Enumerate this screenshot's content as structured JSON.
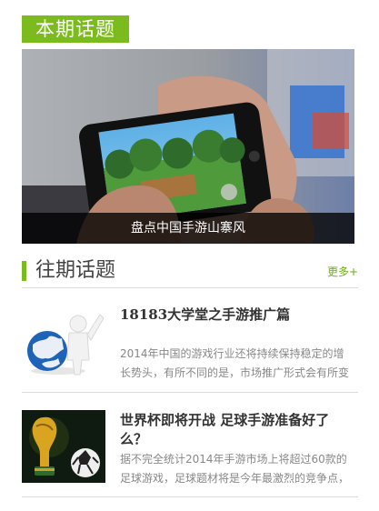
{
  "current": {
    "heading": "本期话题",
    "feature_caption": "盘点中国手游山寨风"
  },
  "past": {
    "heading": "往期话题",
    "more": "更多+",
    "items": [
      {
        "title": "18183大学堂之手游推广篇",
        "desc": "2014年中国的游戏行业还将持续保持稳定的增长势头，有所不同的是，市场推广形式会有所变"
      },
      {
        "title": "世界杯即将开战 足球手游准备好了么？",
        "desc": "据不完全统计2014年手游市场上将超过60款的足球游戏，足球题材将是今年最激烈的竞争点，正"
      }
    ]
  },
  "colors": {
    "accent": "#7cbb1e",
    "more_link": "#6fae1a"
  }
}
